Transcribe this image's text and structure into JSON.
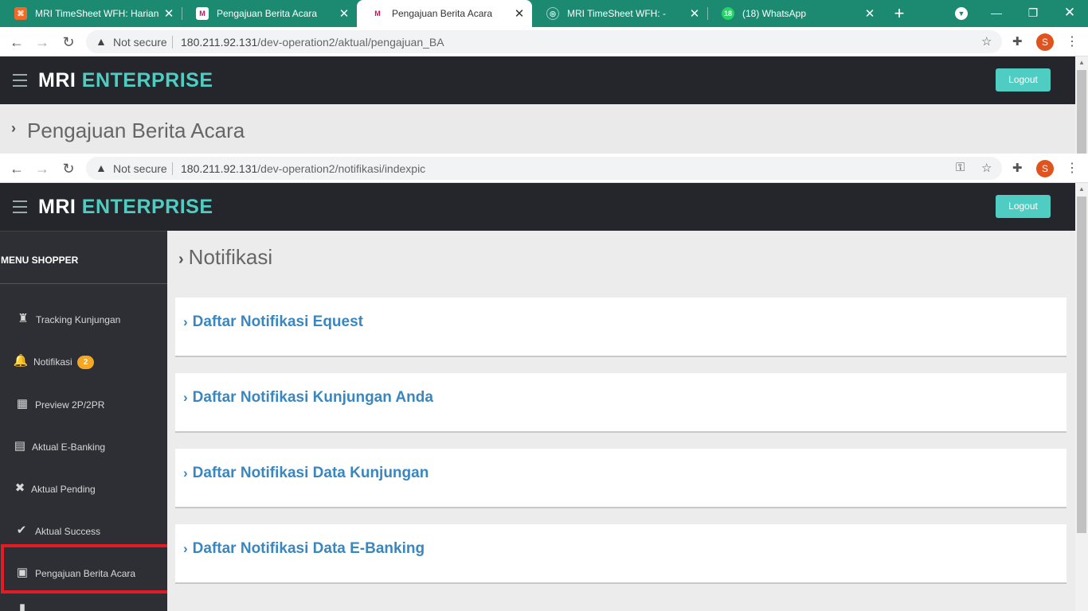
{
  "browser": {
    "tabs": [
      {
        "title": "MRI TimeSheet WFH: Harian",
        "favicon": "orange-app-icon"
      },
      {
        "title": "Pengajuan Berita Acara",
        "favicon": "mri-logo-icon"
      },
      {
        "title": "Pengajuan Berita Acara",
        "favicon": "mri-logo-icon"
      },
      {
        "title": "MRI TimeSheet WFH: -",
        "favicon": "globe-icon"
      },
      {
        "title": "(18) WhatsApp",
        "favicon": "whatsapp-icon",
        "badge": "18"
      }
    ],
    "active_tab": 2,
    "top_window": {
      "security_label": "Not secure",
      "url_host": "180.211.92.131",
      "url_path": "/dev-operation2/aktual/pengajuan_BA",
      "profile_initial": "S"
    },
    "front_window": {
      "security_label": "Not secure",
      "url_host": "180.211.92.131",
      "url_path": "/dev-operation2/notifikasi/indexpic",
      "profile_initial": "S"
    }
  },
  "back_app": {
    "brand_part1": "MRI",
    "brand_part2": "ENTERPRISE",
    "logout_label": "Logout",
    "page_title": "Pengajuan Berita Acara"
  },
  "front_app": {
    "brand_part1": "MRI",
    "brand_part2": "ENTERPRISE",
    "logout_label": "Logout",
    "sidebar": {
      "header": "MENU SHOPPER",
      "items": [
        {
          "label": "Tracking Kunjungan",
          "icon": "trophy-icon"
        },
        {
          "label": "Notifikasi",
          "icon": "bell-icon",
          "badge": "2"
        },
        {
          "label": "Preview 2P/2PR",
          "icon": "table-icon"
        },
        {
          "label": "Aktual E-Banking",
          "icon": "clipboard-icon"
        },
        {
          "label": "Aktual Pending",
          "icon": "close-icon"
        },
        {
          "label": "Aktual Success",
          "icon": "check-icon"
        },
        {
          "label": "Pengajuan Berita Acara",
          "icon": "inbox-icon"
        }
      ]
    },
    "page_title": "Notifikasi",
    "cards": [
      {
        "title": "Daftar Notifikasi Equest"
      },
      {
        "title": "Daftar Notifikasi Kunjungan Anda"
      },
      {
        "title": "Daftar Notifikasi Data Kunjungan"
      },
      {
        "title": "Daftar Notifikasi Data E-Banking"
      }
    ]
  },
  "colors": {
    "tabstrip": "#1b8a70",
    "header_bg": "#25262b",
    "brand_accent": "#4fcdc2",
    "sidebar_bg": "#2d2f35",
    "card_title": "#3a86bf",
    "badge": "#f5a623",
    "highlight_box": "#e51b23"
  }
}
